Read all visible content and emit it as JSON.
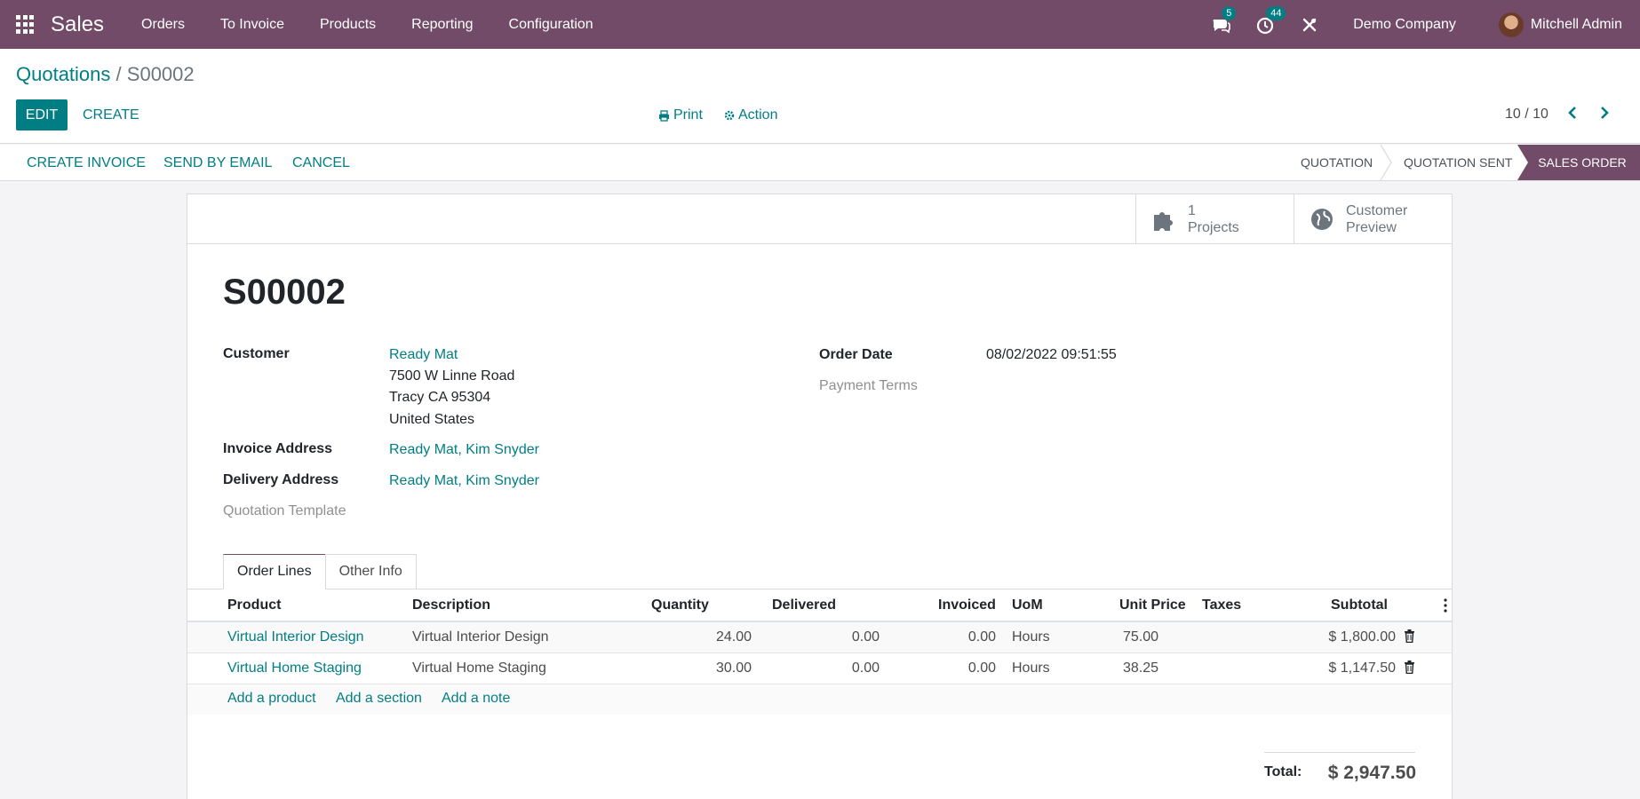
{
  "navbar": {
    "app_name": "Sales",
    "menu": [
      "Orders",
      "To Invoice",
      "Products",
      "Reporting",
      "Configuration"
    ],
    "messages_count": "5",
    "activities_count": "44",
    "company": "Demo Company",
    "user": "Mitchell Admin"
  },
  "breadcrumb": {
    "parent": "Quotations",
    "separator": "/",
    "current": "S00002"
  },
  "toolbar": {
    "edit_label": "EDIT",
    "create_label": "CREATE",
    "print_label": "Print",
    "action_label": "Action",
    "pager": "10 / 10"
  },
  "statusbar": {
    "buttons": [
      "CREATE INVOICE",
      "SEND BY EMAIL",
      "CANCEL"
    ],
    "stages": [
      "QUOTATION",
      "QUOTATION SENT",
      "SALES ORDER"
    ],
    "active_stage": "SALES ORDER"
  },
  "smart_buttons": {
    "projects_count": "1",
    "projects_label": "Projects",
    "preview_line1": "Customer",
    "preview_line2": "Preview"
  },
  "form": {
    "title": "S00002",
    "customer_label": "Customer",
    "customer_name": "Ready Mat",
    "address_line1": "7500 W Linne Road",
    "address_line2": "Tracy CA 95304",
    "address_line3": "United States",
    "invoice_address_label": "Invoice Address",
    "invoice_address": "Ready Mat, Kim Snyder",
    "delivery_address_label": "Delivery Address",
    "delivery_address": "Ready Mat, Kim Snyder",
    "quotation_template_label": "Quotation Template",
    "order_date_label": "Order Date",
    "order_date": "08/02/2022 09:51:55",
    "payment_terms_label": "Payment Terms"
  },
  "tabs": [
    "Order Lines",
    "Other Info"
  ],
  "table": {
    "headers": [
      "Product",
      "Description",
      "Quantity",
      "Delivered",
      "Invoiced",
      "UoM",
      "Unit Price",
      "Taxes",
      "Subtotal"
    ],
    "rows": [
      {
        "product": "Virtual Interior Design",
        "description": "Virtual Interior Design",
        "quantity": "24.00",
        "delivered": "0.00",
        "invoiced": "0.00",
        "uom": "Hours",
        "unit_price": "75.00",
        "taxes": "",
        "subtotal": "$ 1,800.00"
      },
      {
        "product": "Virtual Home Staging",
        "description": "Virtual Home Staging",
        "quantity": "30.00",
        "delivered": "0.00",
        "invoiced": "0.00",
        "uom": "Hours",
        "unit_price": "38.25",
        "taxes": "",
        "subtotal": "$ 1,147.50"
      }
    ],
    "add_links": [
      "Add a product",
      "Add a section",
      "Add a note"
    ]
  },
  "totals": {
    "label": "Total:",
    "value": "$ 2,947.50"
  }
}
